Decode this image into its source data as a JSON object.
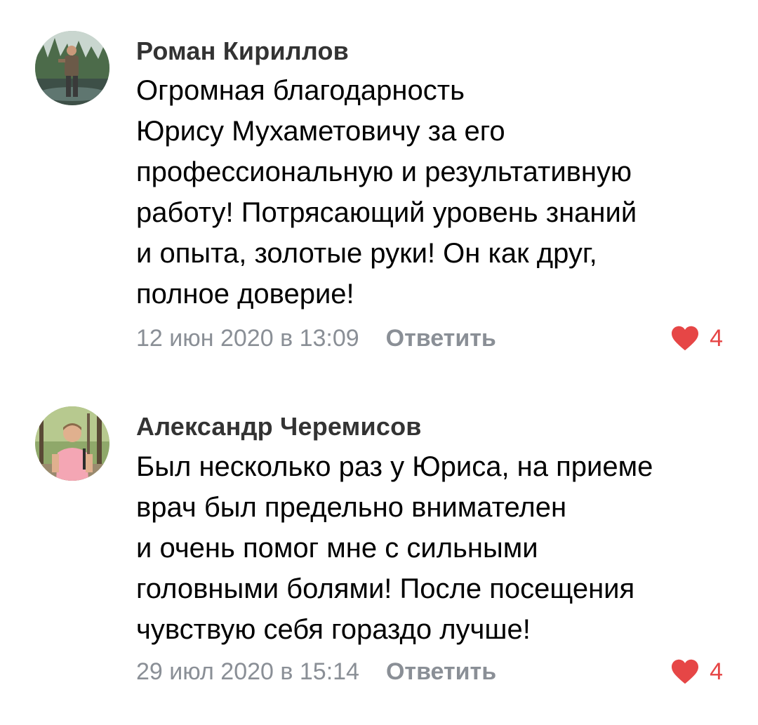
{
  "comments": [
    {
      "author": "Роман Кириллов",
      "text": "Огромная благодарность\nЮрису Мухаметовичу за его\nпрофессиональную и результативную\nработу! Потрясающий уровень знаний\nи опыта, золотые руки!  Он как друг,\nполное доверие!",
      "date": "12 июн 2020 в 13:09",
      "reply_label": "Ответить",
      "likes": "4",
      "avatar_icon": "avatar-photo-man-outdoors"
    },
    {
      "author": "Александр Черемисов",
      "text": "Был несколько раз у Юриса, на приеме\nврач был предельно внимателен\nи очень помог мне с сильными\nголовными болями! После посещения\nчувствую себя гораздо лучше!",
      "date": "29 июл 2020 в 15:14",
      "reply_label": "Ответить",
      "likes": "4",
      "avatar_icon": "avatar-photo-man-park"
    }
  ],
  "colors": {
    "author": "#333333",
    "secondary_text": "#8a8f96",
    "like_accent": "#e64646",
    "background": "#ffffff"
  },
  "icons": {
    "like": "heart-icon"
  }
}
